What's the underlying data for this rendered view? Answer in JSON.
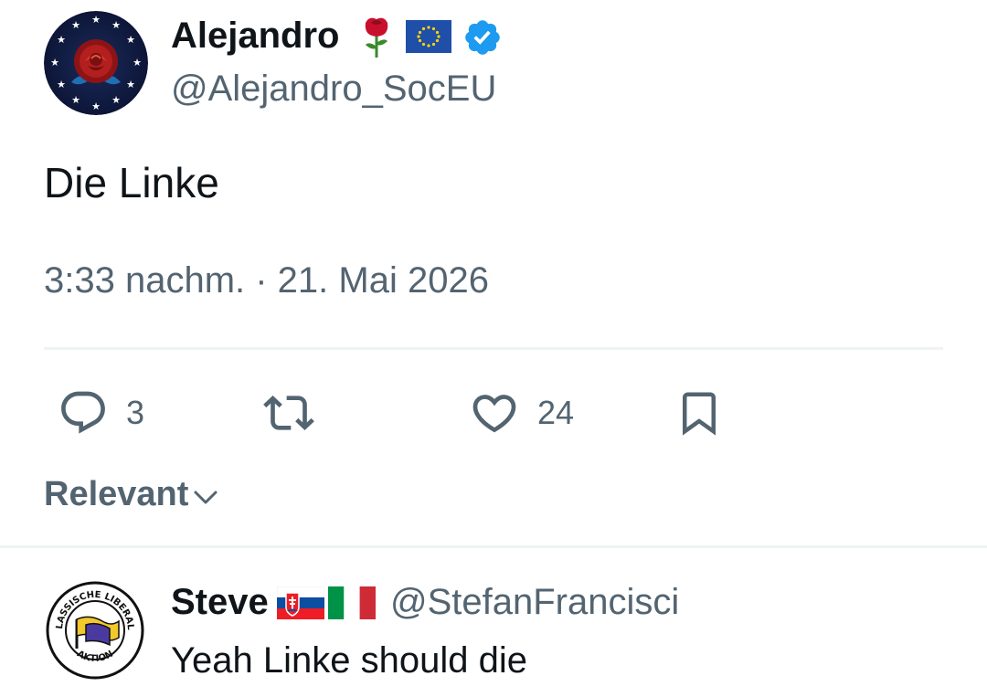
{
  "tweet": {
    "author": {
      "name": "Alejandro",
      "handle": "@Alejandro_SocEU",
      "badges": [
        "rose-emoji-icon",
        "eu-flag-icon",
        "verified-badge-icon"
      ],
      "verified_color": "#1d9bf0"
    },
    "text": "Die Linke",
    "timestamp": "3:33 nachm. · 21. Mai 2026"
  },
  "actions": {
    "reply_count": "3",
    "retweet_count": "",
    "like_count": "24"
  },
  "sort": {
    "label": "Relevant"
  },
  "reply": {
    "author": {
      "name": "Steve",
      "handle": "@StefanFrancisci",
      "flags": [
        "slovakia-flag-icon",
        "italy-flag-icon"
      ]
    },
    "avatar_text_top": "KLASSISCHE LIBERALE",
    "avatar_text_bottom": "AKTION",
    "text": "Yeah Linke should die"
  },
  "colors": {
    "text_primary": "#0f1419",
    "text_secondary": "#536471",
    "divider": "#eff3f4",
    "accent": "#1d9bf0"
  }
}
